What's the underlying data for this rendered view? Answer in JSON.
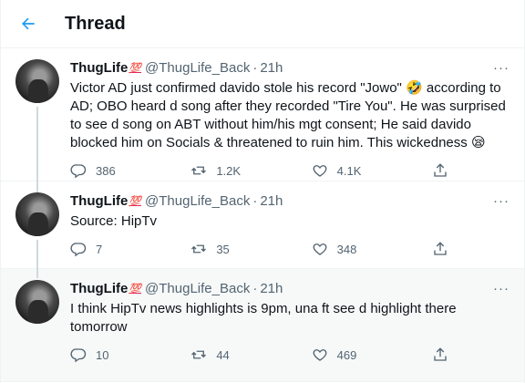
{
  "header": {
    "title": "Thread"
  },
  "tweets": [
    {
      "name": "ThugLife",
      "badge": "💯",
      "handle": "@ThugLife_Back",
      "dot": "·",
      "time": "21h",
      "more": "···",
      "text_part1": "Victor AD just confirmed davido stole his record \"Jowo\" ",
      "emoji1": "🤣",
      "text_part2": " according to AD; OBO heard d song after they recorded \"Tire You\". He was surprised to see d song on ABT without him/his mgt consent; He said davido blocked him on Socials & threatened to ruin him. This wickedness ",
      "emoji2": "😪",
      "replies": "386",
      "retweets": "1.2K",
      "likes": "4.1K"
    },
    {
      "name": "ThugLife",
      "badge": "💯",
      "handle": "@ThugLife_Back",
      "dot": "·",
      "time": "21h",
      "more": "···",
      "text": "Source: HipTv",
      "replies": "7",
      "retweets": "35",
      "likes": "348"
    },
    {
      "name": "ThugLife",
      "badge": "💯",
      "handle": "@ThugLife_Back",
      "dot": "·",
      "time": "21h",
      "more": "···",
      "text": "I think HipTv news highlights is 9pm, una ft see d highlight there tomorrow",
      "replies": "10",
      "retweets": "44",
      "likes": "469"
    }
  ],
  "icons": {
    "back": "arrow-left-icon",
    "reply": "reply-icon",
    "retweet": "retweet-icon",
    "like": "heart-icon",
    "share": "share-icon"
  },
  "colors": {
    "accent": "#1d9bf0",
    "muted": "#536471",
    "highlight_bg": "#f7f9f9"
  }
}
